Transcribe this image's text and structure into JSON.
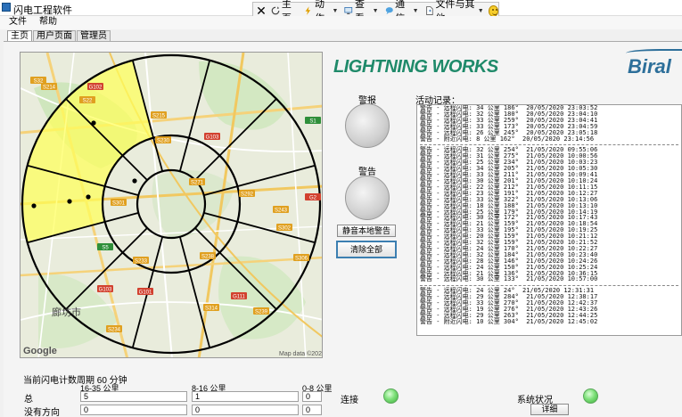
{
  "window": {
    "title": "闪电工程软件"
  },
  "toolbar": {
    "home_label": "主页",
    "actions_label": "动作",
    "view_label": "查看",
    "comms_label": "通信",
    "files_label": "文件与其他"
  },
  "menu": {
    "items": [
      "文件",
      "帮助"
    ]
  },
  "tabs": [
    "主页",
    "用户页面",
    "管理员"
  ],
  "branding": {
    "lightning_works": "LIGHTNING WORKS",
    "biral": "Biral"
  },
  "map": {
    "google_label": "Google",
    "attribution": "Map data ©2020",
    "city_label": "廊坊市",
    "road_labels": [
      "S32",
      "S214",
      "G102",
      "S215",
      "G103",
      "S301",
      "S243",
      "S302",
      "S271",
      "S238",
      "S233",
      "S1",
      "G2",
      "S5",
      "G101",
      "G103",
      "G111",
      "S314",
      "S239",
      "S234",
      "S292",
      "S306",
      "S230",
      "S22"
    ]
  },
  "alarm": {
    "label": "警报"
  },
  "warning": {
    "label": "警告"
  },
  "buttons": {
    "mute_local_warning": "静音本地警告",
    "clear_all": "清除全部",
    "details": "详细"
  },
  "activity": {
    "title": "活动记录：",
    "groups": [
      [
        "警告 - 远程闪电: 34 公里 186°  20/05/2020 23:03:52",
        "警告 - 远程闪电: 32 公里 180°  20/05/2020 23:04:10",
        "警告 - 远程闪电: 33 公里 259°  20/05/2020 23:04:41",
        "警告 - 远程闪电: 33 公里 173°  20/05/2020 23:04:59",
        "警告 - 远程闪电: 26 公里 245°  20/05/2020 23:05:18",
        "警告 - 附近闪电: 8 公里 162°  20/05/2020 23:14:56"
      ],
      [
        "警告 - 远程闪电: 32 公里 254°  21/05/2020 09:55:06",
        "警告 - 远程闪电: 31 公里 275°  21/05/2020 10:00:56",
        "警告 - 远程闪电: 25 公里 234°  21/05/2020 10:03:23",
        "警告 - 远程闪电: 34 公里 205°  21/05/2020 10:05:30",
        "警告 - 远程闪电: 33 公里 211°  21/05/2020 10:09:41",
        "警告 - 远程闪电: 30 公里 201°  21/05/2020 10:10:24",
        "警告 - 远程闪电: 22 公里 212°  21/05/2020 10:11:15",
        "警告 - 远程闪电: 23 公里 191°  21/05/2020 10:12:27",
        "警告 - 远程闪电: 33 公里 322°  21/05/2020 10:13:06",
        "警告 - 远程闪电: 18 公里 188°  21/05/2020 10:13:10",
        "警告 - 远程闪电: 25 公里 179°  21/05/2020 10:14:19",
        "警告 - 远程闪电: 30 公里 172°  21/05/2020 10:17:43",
        "警告 - 远程闪电: 21 公里 159°  21/05/2020 10:18:54",
        "警告 - 远程闪电: 33 公里 195°  21/05/2020 10:19:25",
        "警告 - 远程闪电: 20 公里 159°  21/05/2020 10:21:12",
        "警告 - 远程闪电: 32 公里 159°  21/05/2020 10:21:52",
        "警告 - 远程闪电: 24 公里 170°  21/05/2020 10:22:27",
        "警告 - 远程闪电: 32 公里 184°  21/05/2020 10:23:40",
        "警告 - 远程闪电: 28 公里 146°  21/05/2020 10:24:26",
        "警告 - 远程闪电: 24 公里 150°  21/05/2020 10:25:24",
        "警告 - 远程闪电: 21 公里 136°  21/05/2020 10:36:15",
        "警告 - 远程闪电: 30 公里 133°  21/05/2020 10:57:00"
      ],
      [
        "警告 - 远程闪电: 24 公里 24°  21/05/2020 12:31:31",
        "警告 - 远程闪电: 29 公里 284°  21/05/2020 12:38:17",
        "警告 - 远程闪电: 33 公里 270°  21/05/2020 12:42:37",
        "警告 - 远程闪电: 19 公里 276°  21/05/2020 12:43:26",
        "警告 - 远程闪电: 29 公里 263°  21/05/2020 12:44:25",
        "警告 - 附近闪电: 10 公里 304°  21/05/2020 12:45:02"
      ]
    ]
  },
  "stats": {
    "title": "当前闪电计数周期 60 分钟",
    "columns": [
      "16-35 公里",
      "8-16 公里",
      "0-8 公里"
    ],
    "rows": [
      {
        "label": "总",
        "values": [
          "5",
          "1",
          "0"
        ]
      },
      {
        "label": "没有方向",
        "values": [
          "0",
          "0",
          "0"
        ]
      }
    ]
  },
  "status": {
    "connection_label": "连接",
    "system_label": "系统状况"
  },
  "colors": {
    "sector_fill": "#ffff5a",
    "led_green": "#5ed05a",
    "brand_green": "#1f8a6a",
    "brand_blue": "#2d6f9a"
  }
}
